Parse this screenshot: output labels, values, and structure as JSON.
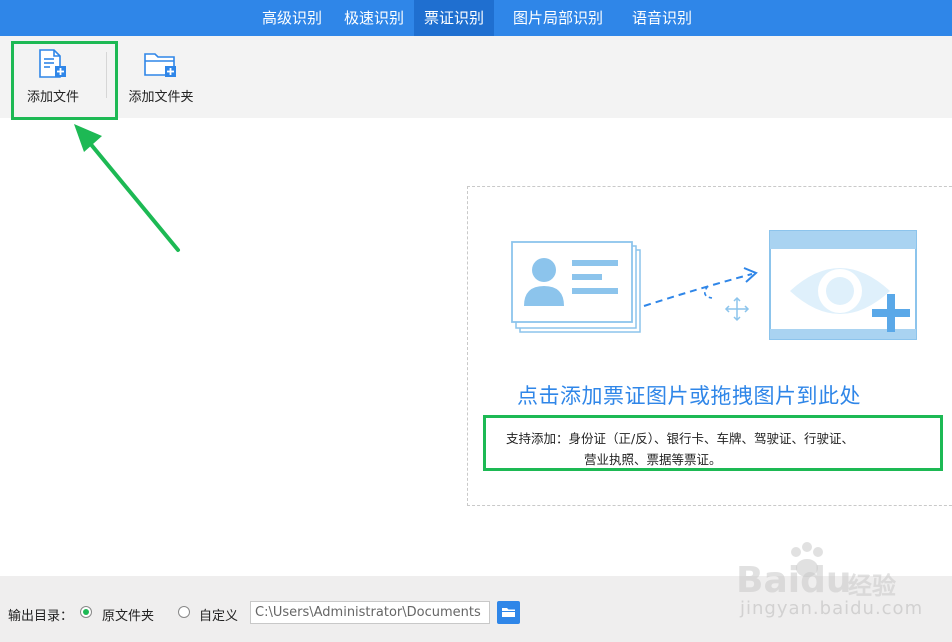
{
  "nav": {
    "tabs": [
      {
        "label": "高级识别"
      },
      {
        "label": "极速识别"
      },
      {
        "label": "票证识别"
      },
      {
        "label": "图片局部识别"
      },
      {
        "label": "语音识别"
      }
    ],
    "active_tab": "票证识别"
  },
  "toolbar": {
    "add_file_label": "添加文件",
    "add_folder_label": "添加文件夹"
  },
  "dropzone": {
    "title": "点击添加票证图片或拖拽图片到此处",
    "hint_line1": "支持添加：身份证（正/反）、银行卡、车牌、驾驶证、行驶证、",
    "hint_line2": "营业执照、票据等票证。"
  },
  "footer": {
    "output_label": "输出目录：",
    "option_original": "原文件夹",
    "option_custom": "自定义",
    "selected_option": "原文件夹",
    "path_value": "C:\\Users\\Administrator\\Documents"
  },
  "watermark": {
    "brand": "Baidu",
    "brand_cn": "经验",
    "url": "jingyan.baidu.com"
  },
  "colors": {
    "accent": "#2f86e8",
    "active_tab": "#1f6fd0",
    "highlight": "#1db954",
    "illustration": "#8cc4ec"
  },
  "icons": {
    "add_file": "add-file-icon",
    "add_folder": "add-folder-icon",
    "browse": "folder-icon",
    "card": "id-card-icon",
    "eye": "eye-icon",
    "move": "move-icon"
  }
}
